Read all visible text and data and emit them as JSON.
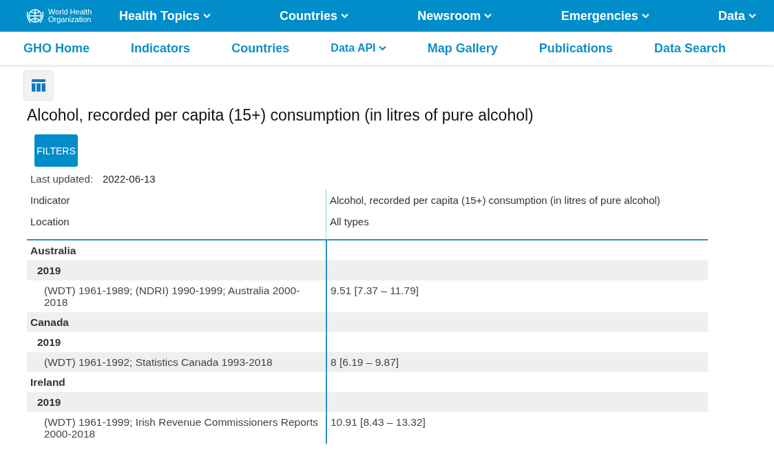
{
  "logo": {
    "text": "World Health Organization"
  },
  "top_nav": [
    {
      "label": "Health Topics",
      "dropdown": true
    },
    {
      "label": "Countries",
      "dropdown": true
    },
    {
      "label": "Newsroom",
      "dropdown": true
    },
    {
      "label": "Emergencies",
      "dropdown": true
    },
    {
      "label": "Data",
      "dropdown": true
    }
  ],
  "sub_nav": [
    {
      "label": "GHO Home",
      "dropdown": false
    },
    {
      "label": "Indicators",
      "dropdown": false
    },
    {
      "label": "Countries",
      "dropdown": false
    },
    {
      "label": "Data API",
      "dropdown": true
    },
    {
      "label": "Map Gallery",
      "dropdown": false
    },
    {
      "label": "Publications",
      "dropdown": false
    },
    {
      "label": "Data Search",
      "dropdown": false
    }
  ],
  "title": "Alcohol, recorded per capita (15+) consumption (in litres of pure alcohol)",
  "filters_button": "FILTERS",
  "last_updated": {
    "label": "Last updated:",
    "value": "2022-06-13"
  },
  "table": {
    "header": [
      {
        "label": "Indicator",
        "value": "Alcohol, recorded per capita (15+) consumption (in litres of pure alcohol)"
      },
      {
        "label": "Location",
        "value": "All types"
      }
    ],
    "rows": [
      {
        "label": "Australia",
        "children": [
          {
            "label": "2019",
            "children": [
              {
                "label": "(WDT) 1961-1989; (NDRI) 1990-1999; Australia 2000-2018",
                "value": "9.51 [7.37 – 11.79]"
              }
            ]
          }
        ]
      },
      {
        "label": "Canada",
        "children": [
          {
            "label": "2019",
            "children": [
              {
                "label": "(WDT) 1961-1992; Statistics Canada 1993-2018",
                "value": "8 [6.19 – 9.87]"
              }
            ]
          }
        ]
      },
      {
        "label": "Ireland",
        "children": [
          {
            "label": "2019",
            "children": [
              {
                "label": "(WDT) 1961-1999; Irish Revenue Commissioners Reports 2000-2018",
                "value": "10.91 [8.43 – 13.32]"
              }
            ]
          }
        ]
      }
    ]
  }
}
